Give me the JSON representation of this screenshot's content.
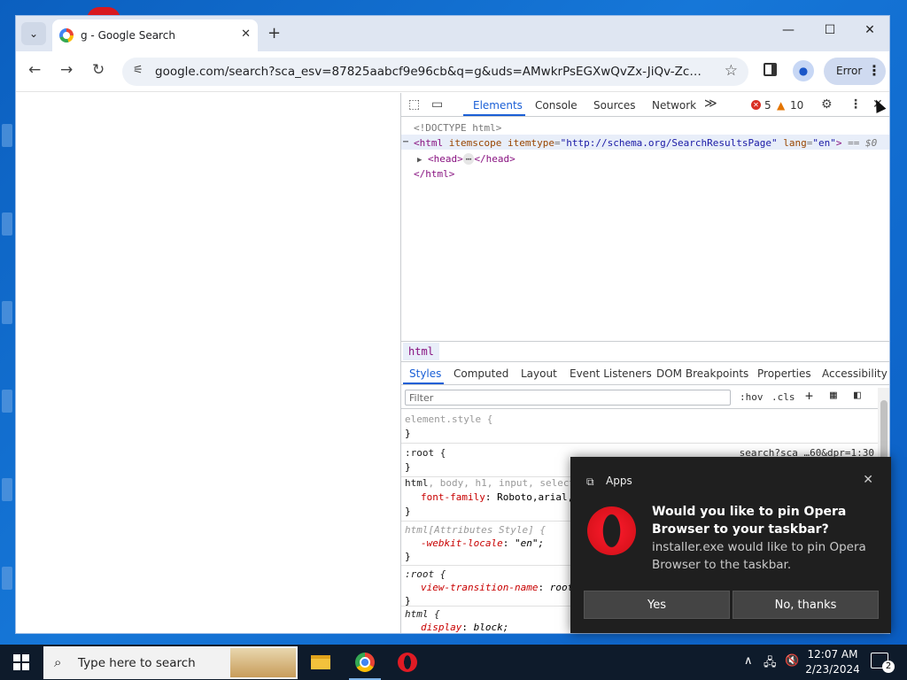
{
  "browser": {
    "tab": {
      "title": "g - Google Search",
      "close_glyph": "✕"
    },
    "tab_menu_glyph": "⌄",
    "new_tab_glyph": "+",
    "window_controls": {
      "minimize": "—",
      "maximize": "☐",
      "close": "✕"
    },
    "nav": {
      "back": "←",
      "forward": "→",
      "reload": "↻"
    },
    "address": {
      "url": "google.com/search?sca_esv=87825aabcf9e96cb&q=g&uds=AMwkrPsEGXwQvZx-JiQv-ZcDS8ASIN3...",
      "star": "☆"
    },
    "profile_chip": {
      "label": "Error",
      "menu_glyph": "⋮"
    }
  },
  "devtools": {
    "tabs": [
      "Elements",
      "Console",
      "Sources",
      "Network"
    ],
    "more_tabs_glyph": "≫",
    "error_count": "5",
    "warning_count": "10",
    "warning_glyph": "▲",
    "settings_glyph": "⚙",
    "kebab_glyph": "⋮",
    "close_glyph": "✕",
    "dom": {
      "doctype": "<!DOCTYPE html>",
      "html_open_tag": "<html",
      "attr1_name": " itemscope",
      "attr2_name": " itemtype",
      "attr2_value": "\"http://schema.org/SearchResultsPage\"",
      "attr3_name": " lang",
      "attr3_value": "\"en\"",
      "eq": "=",
      "html_open_close": ">",
      "selected_marker": "== $0",
      "head_open": "<head>",
      "head_dots": "⋯",
      "head_close": "</head>",
      "html_close": "</html>",
      "ellipsis": "⋯"
    },
    "breadcrumb": "html",
    "subtabs": [
      "Styles",
      "Computed",
      "Layout",
      "Event Listeners",
      "DOM Breakpoints",
      "Properties",
      "Accessibility"
    ],
    "filter_placeholder": "Filter",
    "hov": ":hov",
    "cls": ".cls",
    "add_glyph": "+",
    "styles": {
      "rule1_selector": "element.style {",
      "brace_close": "}",
      "rule2_selector": ":root {",
      "rule2_source": "search?sca_…60&dpr=1:30",
      "rule3_sel_main": "html",
      "rule3_sel_faded": ", body, h1, input, select",
      "rule3_prop": "font-family",
      "rule3_value": "Roboto,arial,",
      "rule4_selector": "html[Attributes Style] {",
      "rule4_prop": "-webkit-locale",
      "rule4_value": "\"en\";",
      "rule5_selector": ":root {",
      "rule5_prop": "view-transition-name",
      "rule5_value": "root",
      "rule6_selector": "html {",
      "rule6_prop": "display",
      "rule6_value": "block;"
    }
  },
  "notification": {
    "app_name": "Apps",
    "close_glyph": "✕",
    "title": "Would you like to pin Opera Browser to your taskbar?",
    "body": "installer.exe would like to pin Opera Browser to the taskbar.",
    "yes": "Yes",
    "no": "No, thanks"
  },
  "taskbar": {
    "search_placeholder": "Type here to search",
    "time": "12:07 AM",
    "date": "2/23/2024",
    "notification_count": "2",
    "tray_chevron": "∧"
  }
}
